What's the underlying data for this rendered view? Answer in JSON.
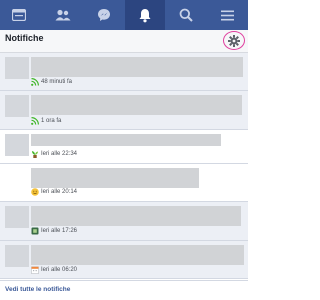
{
  "header": {
    "title": "Notifiche"
  },
  "nav": {
    "tabs": [
      {
        "name": "feed-icon"
      },
      {
        "name": "friends-icon"
      },
      {
        "name": "messages-icon"
      },
      {
        "name": "notifications-icon",
        "active": true
      },
      {
        "name": "search-icon"
      },
      {
        "name": "menu-icon"
      }
    ]
  },
  "notifications": [
    {
      "time": "48 minuti fa",
      "icon": "rss-icon",
      "unread": true
    },
    {
      "time": "1 ora fa",
      "icon": "rss-icon",
      "unread": true
    },
    {
      "time": "Ieri alle 22:34",
      "icon": "plant-icon",
      "unread": false
    },
    {
      "time": "Ieri alle 20:14",
      "icon": "smiley-icon",
      "unread": false
    },
    {
      "time": "Ieri alle 17:26",
      "icon": "app-icon",
      "unread": true
    },
    {
      "time": "Ieri alle 06:20",
      "icon": "calendar-icon",
      "unread": true
    }
  ],
  "footer": {
    "see_all": "Vedi tutte le notifiche"
  },
  "colors": {
    "brand": "#3b5998",
    "unread_bg": "#eceff5",
    "highlight_ring": "#e0409f"
  }
}
